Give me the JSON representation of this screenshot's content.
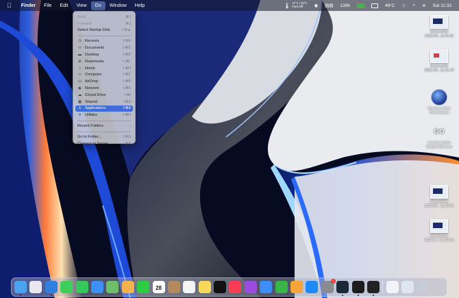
{
  "menubar": {
    "app_name": "Finder",
    "menus": [
      "File",
      "Edit",
      "View",
      "Go",
      "Window",
      "Help"
    ],
    "active_menu": "Go",
    "status": {
      "temp_line1": "47°C | 48°C",
      "temp_line2": "Fans Off",
      "count": "1396",
      "temperature": "48°C",
      "clock": "Sat  11:33"
    }
  },
  "go_menu": {
    "items": [
      {
        "label": "Back",
        "shortcut": "⌘ [",
        "disabled": true,
        "icon": ""
      },
      {
        "label": "Forward",
        "shortcut": "⌘ ]",
        "disabled": true,
        "icon": ""
      },
      {
        "label": "Select Startup Disk",
        "shortcut": "⇧⌘▲",
        "disabled": false,
        "icon": ""
      },
      {
        "sep": true
      },
      {
        "label": "Recents",
        "shortcut": "⇧⌘F",
        "icon": "clock-icon"
      },
      {
        "label": "Documents",
        "shortcut": "⇧⌘O",
        "icon": "document-icon"
      },
      {
        "label": "Desktop",
        "shortcut": "⇧⌘D",
        "icon": "desktop-icon"
      },
      {
        "label": "Downloads",
        "shortcut": "⌥⌘L",
        "icon": "download-icon"
      },
      {
        "label": "Home",
        "shortcut": "⇧⌘H",
        "icon": "home-icon"
      },
      {
        "label": "Computer",
        "shortcut": "⇧⌘C",
        "icon": "computer-icon"
      },
      {
        "label": "AirDrop",
        "shortcut": "⇧⌘R",
        "icon": "airdrop-icon"
      },
      {
        "label": "Network",
        "shortcut": "⇧⌘K",
        "icon": "network-icon"
      },
      {
        "label": "iCloud Drive",
        "shortcut": "⇧⌘I",
        "icon": "cloud-icon"
      },
      {
        "label": "Shared",
        "shortcut": "⇧⌘S",
        "icon": "shared-icon"
      },
      {
        "label": "Applications",
        "shortcut": "⇧⌘A",
        "icon": "applications-icon",
        "highlighted": true
      },
      {
        "label": "Utilities",
        "shortcut": "⇧⌘U",
        "icon": "utilities-icon"
      },
      {
        "sep": true
      },
      {
        "label": "Recent Folders",
        "shortcut": "›",
        "icon": ""
      },
      {
        "sep": true
      },
      {
        "label": "Go to Folder...",
        "shortcut": "⇧⌘G",
        "icon": ""
      },
      {
        "label": "Connect to Server...",
        "shortcut": "⌘K",
        "icon": ""
      }
    ]
  },
  "desktop": {
    "icons": [
      {
        "name": "screenshot-file-1",
        "label1": "Screenshot",
        "label2": "2022-05...A-04-35",
        "kind": "thumb",
        "muted": true
      },
      {
        "name": "screenshot-file-2",
        "label1": "Screenshot",
        "label2": "2022-05...11.31.40",
        "kind": "thumb-light",
        "muted": true
      },
      {
        "name": "shadow-of-the-tomb-raider",
        "label1": "Shadow of the",
        "label2": "Tomb Raider",
        "kind": "circle"
      },
      {
        "name": "counter-strike",
        "label1": "Counter-Strike",
        "label2": "Global Offensive",
        "kind": "cs",
        "glyph": "GO"
      },
      {
        "name": "screenshot-file-3",
        "label1": "Screenshot",
        "label2": "2022-05...11.32.51",
        "kind": "thumb"
      },
      {
        "name": "screenshot-file-4",
        "label1": "Screenshot",
        "label2": "2022-0...t 11.33.14",
        "kind": "thumb"
      }
    ]
  },
  "dock": {
    "calendar_date": "28",
    "badge_count": "1",
    "apps": [
      {
        "name": "finder",
        "color": "#4aa3f0",
        "dot": true
      },
      {
        "name": "launchpad",
        "color": "#e8e8ee"
      },
      {
        "name": "safari",
        "color": "#2f7fe0",
        "dot": true
      },
      {
        "name": "messages",
        "color": "#3ecf5a"
      },
      {
        "name": "facetime",
        "color": "#34c759"
      },
      {
        "name": "mail",
        "color": "#3b8ff5"
      },
      {
        "name": "maps",
        "color": "#6cc06b"
      },
      {
        "name": "photos",
        "color": "#f3b34a"
      },
      {
        "name": "facetime-video",
        "color": "#2ecc40"
      },
      {
        "name": "calendar",
        "color": "#ffffff",
        "calendar": true
      },
      {
        "name": "contacts",
        "color": "#b28a5c"
      },
      {
        "name": "reminders",
        "color": "#f4f4f4"
      },
      {
        "name": "notes",
        "color": "#f8d75a"
      },
      {
        "name": "apple-tv",
        "color": "#111111"
      },
      {
        "name": "music",
        "color": "#fa3d55"
      },
      {
        "name": "podcasts",
        "color": "#9b4be0"
      },
      {
        "name": "keynote",
        "color": "#3e8ef7"
      },
      {
        "name": "numbers",
        "color": "#39b54a"
      },
      {
        "name": "pages",
        "color": "#f6a53b"
      },
      {
        "name": "app-store",
        "color": "#1d8af5"
      },
      {
        "name": "system-preferences",
        "color": "#8a8a8f",
        "badge": true
      },
      {
        "name": "steam",
        "color": "#1b2838",
        "dot": true
      },
      {
        "name": "terminal",
        "color": "#1c1c1e",
        "dot": true
      },
      {
        "name": "game-app",
        "color": "#222222",
        "dot": true
      },
      {
        "divider": true
      },
      {
        "name": "document",
        "color": "#f2f2f7"
      },
      {
        "name": "preview",
        "color": "#dfe6f2"
      },
      {
        "name": "trash",
        "color": "#c8ccd6"
      }
    ]
  }
}
